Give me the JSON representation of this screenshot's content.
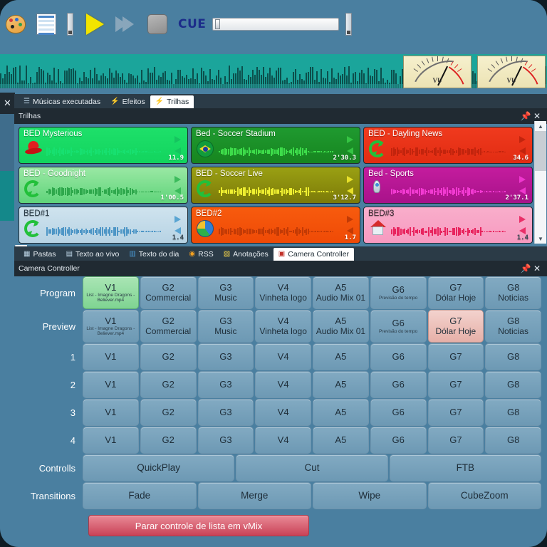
{
  "toolbar": {
    "icons": [
      "palette-icon",
      "playlist-icon",
      "dock-tab-icon",
      "play-icon",
      "fast-forward-icon",
      "stop-icon"
    ],
    "cue_label": "CUE",
    "slider_value": 0
  },
  "vu_meters": [
    {
      "label": "VU"
    },
    {
      "label": "VU"
    }
  ],
  "trilhas_panel": {
    "title": "Trilhas",
    "tabs": [
      {
        "label": "Músicas executadas",
        "glyph": "☰",
        "active": false,
        "icon": "list-icon"
      },
      {
        "label": "Efeitos",
        "glyph": "⚡",
        "active": false,
        "icon": "bolt-icon"
      },
      {
        "label": "Trilhas",
        "glyph": "⚡",
        "active": true,
        "icon": "bolt-icon"
      }
    ],
    "pin_glyph": "⚕",
    "close_glyph": "✕",
    "tracks": [
      {
        "name": "BED  Mysterious",
        "time": "11.9",
        "icon": "red-hat-icon",
        "bg": "linear-gradient(180deg,#1ee06a,#12d45e)",
        "wave": "#17e070",
        "arrow": "#15c45f",
        "title_color": "#ffffff"
      },
      {
        "name": "Bed -  Soccer Stadium",
        "time": "2'30.3",
        "icon": "brazil-flag-icon",
        "bg": "linear-gradient(180deg,#1f9a30,#17851f)",
        "wave": "#3ddc4a",
        "arrow": "#35c443",
        "title_color": "#ffffff"
      },
      {
        "name": "BED - Dayling News",
        "time": "34.6",
        "icon": "loop-icon",
        "bg": "linear-gradient(180deg,#f03a1e,#e12c12)",
        "wave": "#c2240d",
        "arrow": "#c2240d",
        "title_color": "#ffffff"
      },
      {
        "name": "BED - Goodnight",
        "time": "1'00.5",
        "icon": "loop-icon",
        "bg": "linear-gradient(180deg,#9ae8a4,#5fd47a)",
        "wave": "#2ea84c",
        "arrow": "#3cbb5c",
        "title_color": "#ffffff"
      },
      {
        "name": "BED -  Soccer  Live",
        "time": "3'12.7",
        "icon": "loop-icon",
        "bg": "linear-gradient(180deg,#9aa013,#7c7a08)",
        "wave": "#eeee30",
        "arrow": "#e8e02a",
        "title_color": "#ffffff"
      },
      {
        "name": "Bed - Sports",
        "time": "2'37.1",
        "icon": "rocket-icon",
        "bg": "linear-gradient(180deg,#c41c9e,#a8128a)",
        "wave": "#f23ad2",
        "arrow": "#ef37ce",
        "title_color": "#ffffff"
      },
      {
        "name": "BED#1",
        "time": "1.4",
        "icon": "loop-icon",
        "bg": "linear-gradient(180deg,#cfe3ee,#b7d3e4)",
        "wave": "#4e96c6",
        "arrow": "#5aa5d2",
        "title_color": "#2a3b46"
      },
      {
        "name": "BED#2",
        "time": "1.7",
        "icon": "pie-chart-icon",
        "bg": "linear-gradient(180deg,#f75b0e,#ef4a06)",
        "wave": "#c23a05",
        "arrow": "#c23a05",
        "title_color": "#ffffff"
      },
      {
        "name": "BED#3",
        "time": "1.4",
        "icon": "house-icon",
        "bg": "linear-gradient(180deg,#f9aecb,#f79ac0)",
        "wave": "#e8245e",
        "arrow": "#ea2f68",
        "title_color": "#3a2b33"
      }
    ]
  },
  "camera_panel": {
    "title": "Camera Controller",
    "tabs": [
      {
        "label": "Pastas",
        "glyph": "▦",
        "active": false,
        "icon": "folders-icon"
      },
      {
        "label": "Texto ao vivo",
        "glyph": "▤",
        "active": false,
        "icon": "document-icon"
      },
      {
        "label": "Texto do dia",
        "glyph": "▥",
        "active": false,
        "icon": "calendar-text-icon"
      },
      {
        "label": "RSS",
        "glyph": "◉",
        "active": false,
        "icon": "rss-icon"
      },
      {
        "label": "Anotações",
        "glyph": "▧",
        "active": false,
        "icon": "notes-icon"
      },
      {
        "label": "Camera Controller",
        "glyph": "▣",
        "active": true,
        "icon": "camera-icon"
      }
    ],
    "pin_glyph": "⚕",
    "close_glyph": "✕",
    "inputs": [
      {
        "id": "V1",
        "sub": "List - Imagne Dragons - Believer.mp4"
      },
      {
        "id": "G2",
        "sub": "Commercial"
      },
      {
        "id": "G3",
        "sub": "Music"
      },
      {
        "id": "V4",
        "sub": "Vinheta logo"
      },
      {
        "id": "A5",
        "sub": "Audio Mix 01"
      },
      {
        "id": "G6",
        "sub": "Previsão do tempo"
      },
      {
        "id": "G7",
        "sub": "Dólar Hoje"
      },
      {
        "id": "G8",
        "sub": "Noticias"
      }
    ],
    "rows": [
      {
        "label": "Program",
        "type": "named",
        "active_index": 0,
        "active_style": "green"
      },
      {
        "label": "Preview",
        "type": "named",
        "active_index": 6,
        "active_style": "pink"
      },
      {
        "label": "1",
        "type": "plain",
        "active_index": -1,
        "active_style": ""
      },
      {
        "label": "2",
        "type": "plain",
        "active_index": -1,
        "active_style": ""
      },
      {
        "label": "3",
        "type": "plain",
        "active_index": -1,
        "active_style": ""
      },
      {
        "label": "4",
        "type": "plain",
        "active_index": -1,
        "active_style": ""
      }
    ],
    "controls_label": "Controlls",
    "controls": [
      "QuickPlay",
      "Cut",
      "FTB"
    ],
    "transitions_label": "Transitions",
    "transitions": [
      "Fade",
      "Merge",
      "Wipe",
      "CubeZoom"
    ],
    "stop_button": "Parar controle de lista em vMix"
  },
  "colors": {
    "app_bg": "#4a7fa0",
    "panel_dark": "#2f3b45",
    "title_dark": "#202a32",
    "cell": "#7aa3bd",
    "accent_green": "#8fdc9f",
    "accent_pink": "#ecc0b8",
    "danger": "#c94257",
    "wave_strip": "#1ba59b"
  }
}
